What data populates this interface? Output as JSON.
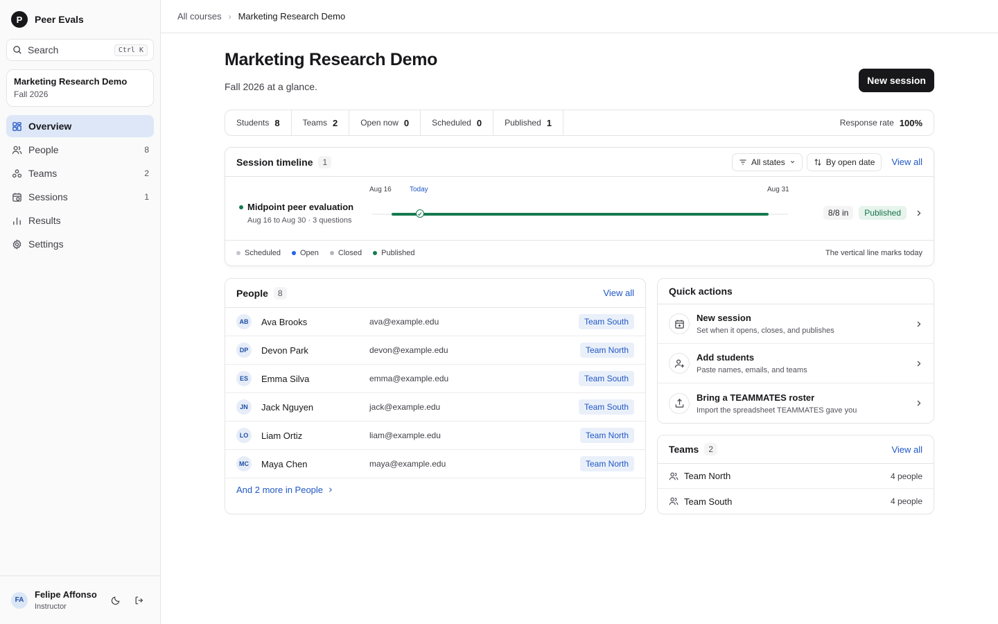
{
  "app": {
    "logo_letter": "P",
    "name": "Peer Evals"
  },
  "search": {
    "label": "Search",
    "shortcut": "Ctrl K"
  },
  "course": {
    "title": "Marketing Research Demo",
    "term": "Fall 2026"
  },
  "nav": [
    {
      "label": "Overview",
      "count": "",
      "icon": "grid-icon",
      "active": true
    },
    {
      "label": "People",
      "count": "8",
      "icon": "users-icon"
    },
    {
      "label": "Teams",
      "count": "2",
      "icon": "teams-icon"
    },
    {
      "label": "Sessions",
      "count": "1",
      "icon": "calendar-clock-icon"
    },
    {
      "label": "Results",
      "count": "",
      "icon": "bar-chart-icon"
    },
    {
      "label": "Settings",
      "count": "",
      "icon": "gear-icon"
    }
  ],
  "user": {
    "initials": "FA",
    "name": "Felipe Affonso",
    "role": "Instructor"
  },
  "breadcrumb": {
    "root": "All courses",
    "current": "Marketing Research Demo"
  },
  "page": {
    "title": "Marketing Research Demo",
    "subtitle": "Fall 2026 at a glance.",
    "primary_button": "New session"
  },
  "stats": {
    "students": {
      "label": "Students",
      "value": "8"
    },
    "teams": {
      "label": "Teams",
      "value": "2"
    },
    "open_now": {
      "label": "Open now",
      "value": "0"
    },
    "scheduled": {
      "label": "Scheduled",
      "value": "0"
    },
    "published": {
      "label": "Published",
      "value": "1"
    },
    "response_rate": {
      "label": "Response rate",
      "value": "100%"
    }
  },
  "timeline": {
    "title": "Session timeline",
    "count": "1",
    "filter_states": "All states",
    "sort": "By open date",
    "view_all": "View all",
    "date_start": "Aug 16",
    "date_today": "Today",
    "date_end": "Aug 31",
    "session": {
      "name": "Midpoint peer evaluation",
      "meta": "Aug 16 to Aug 30 · 3 questions",
      "responses": "8/8 in",
      "status": "Published",
      "elapsed_fraction": 0.075
    },
    "legend": [
      {
        "label": "Scheduled",
        "color": "#c4c4cc"
      },
      {
        "label": "Open",
        "color": "#2563eb"
      },
      {
        "label": "Closed",
        "color": "#b4b4bb"
      },
      {
        "label": "Published",
        "color": "#167a4f"
      }
    ],
    "note": "The vertical line marks today"
  },
  "people": {
    "title": "People",
    "count": "8",
    "view_all": "View all",
    "rows": [
      {
        "initials": "AB",
        "name": "Ava Brooks",
        "email": "ava@example.edu",
        "team": "Team South"
      },
      {
        "initials": "DP",
        "name": "Devon Park",
        "email": "devon@example.edu",
        "team": "Team North"
      },
      {
        "initials": "ES",
        "name": "Emma Silva",
        "email": "emma@example.edu",
        "team": "Team South"
      },
      {
        "initials": "JN",
        "name": "Jack Nguyen",
        "email": "jack@example.edu",
        "team": "Team South"
      },
      {
        "initials": "LO",
        "name": "Liam Ortiz",
        "email": "liam@example.edu",
        "team": "Team North"
      },
      {
        "initials": "MC",
        "name": "Maya Chen",
        "email": "maya@example.edu",
        "team": "Team North"
      }
    ],
    "more_link": "And 2 more in People"
  },
  "quick_actions": {
    "title": "Quick actions",
    "items": [
      {
        "title": "New session",
        "desc": "Set when it opens, closes, and publishes",
        "icon": "calendar-plus-icon"
      },
      {
        "title": "Add students",
        "desc": "Paste names, emails, and teams",
        "icon": "user-plus-icon"
      },
      {
        "title": "Bring a TEAMMATES roster",
        "desc": "Import the spreadsheet TEAMMATES gave you",
        "icon": "upload-icon"
      }
    ]
  },
  "teams": {
    "title": "Teams",
    "count": "2",
    "view_all": "View all",
    "rows": [
      {
        "name": "Team North",
        "count": "4 people"
      },
      {
        "name": "Team South",
        "count": "4 people"
      }
    ]
  }
}
